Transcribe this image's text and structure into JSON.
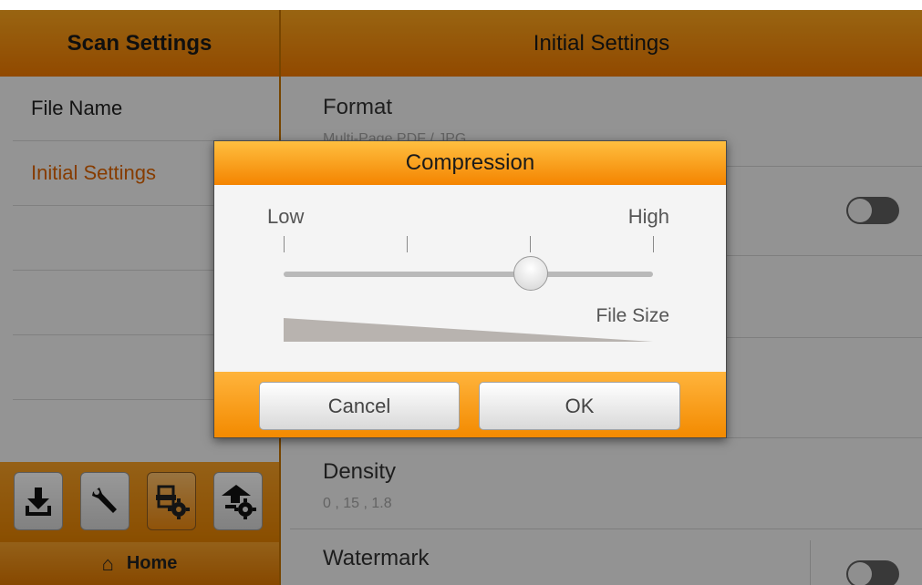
{
  "left_panel": {
    "title": "Scan Settings",
    "menu": [
      {
        "label": "File Name"
      },
      {
        "label": "Initial Settings"
      },
      {
        "label": ""
      },
      {
        "label": ""
      },
      {
        "label": ""
      }
    ],
    "toolbar": [
      {
        "icon": "download-icon"
      },
      {
        "icon": "wrench-icon"
      },
      {
        "icon": "scanner-settings-icon"
      },
      {
        "icon": "upload-settings-icon"
      }
    ],
    "home_label": "Home",
    "home_icon": "home-icon"
  },
  "right_panel": {
    "title": "Initial Settings",
    "format": {
      "label": "Format",
      "value": "Multi-Page PDF / JPG"
    },
    "density": {
      "label": "Density",
      "value": "0 , 15 , 1.8"
    },
    "watermark": {
      "label": "Watermark"
    }
  },
  "dialog": {
    "title": "Compression",
    "low_label": "Low",
    "high_label": "High",
    "file_size_label": "File Size",
    "slider_position": 0.67,
    "cancel_label": "Cancel",
    "ok_label": "OK"
  },
  "colors": {
    "accent": "#f28a00",
    "active_text": "#e06500"
  }
}
